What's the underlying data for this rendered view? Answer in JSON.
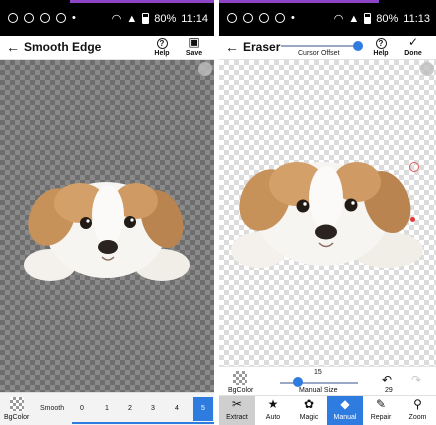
{
  "left": {
    "status_time": "11:14",
    "battery": "80%",
    "title": "Smooth Edge",
    "help_label": "Help",
    "save_label": "Save",
    "bgcolor_label": "BgColor",
    "smooth_label": "Smooth",
    "smooth_options": [
      "0",
      "1",
      "2",
      "3",
      "4",
      "5"
    ],
    "smooth_selected": "5"
  },
  "right": {
    "status_time": "11:13",
    "battery": "80%",
    "title": "Eraser",
    "cursor_offset_label": "Cursor Offset",
    "help_label": "Help",
    "done_label": "Done",
    "bgcolor_label": "BgColor",
    "manual_size_value": "15",
    "manual_size_label": "Manual Size",
    "undo_count": "29",
    "tools": [
      {
        "icon": "scissors-icon",
        "label": "Extract"
      },
      {
        "icon": "star-icon",
        "label": "Auto"
      },
      {
        "icon": "magic-icon",
        "label": "Magic"
      },
      {
        "icon": "eraser-icon",
        "label": "Manual"
      },
      {
        "icon": "brush-icon",
        "label": "Repair"
      },
      {
        "icon": "zoom-icon",
        "label": "Zoom"
      }
    ],
    "selected_tool": "Manual"
  },
  "colors": {
    "accent": "#2f7ce0",
    "status_bar": "#000000",
    "notification_bar": "#8e44c7"
  }
}
